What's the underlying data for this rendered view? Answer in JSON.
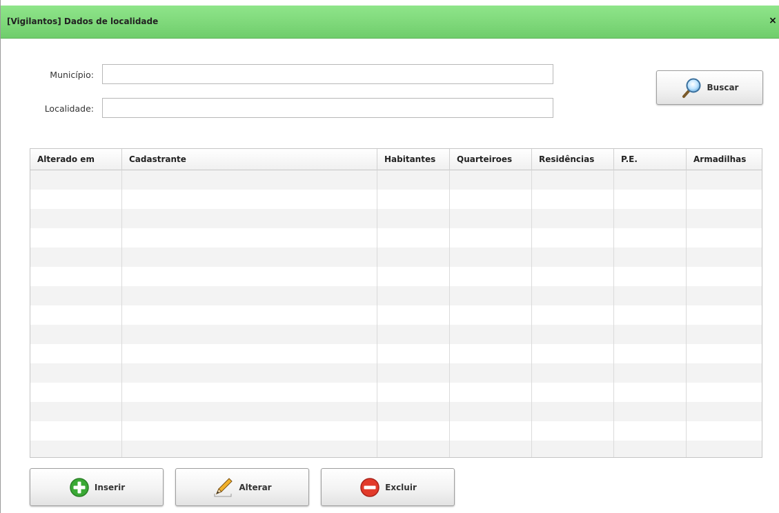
{
  "window": {
    "title": "[Vigilantos] Dados de localidade",
    "close_label": "×"
  },
  "form": {
    "municipio_label": "Município:",
    "municipio_value": "",
    "localidade_label": "Localidade:",
    "localidade_value": "",
    "buscar_label": "Buscar"
  },
  "table": {
    "columns": [
      "Alterado em",
      "Cadastrante",
      "Habitantes",
      "Quarteiroes",
      "Residências",
      "P.E.",
      "Armadilhas"
    ],
    "rows": []
  },
  "actions": {
    "inserir_label": "Inserir",
    "alterar_label": "Alterar",
    "excluir_label": "Excluir"
  },
  "colors": {
    "titlebar": "#7ed87a",
    "add_icon": "#3aa935",
    "delete_icon": "#e23a2a"
  },
  "icons": {
    "search": "magnifier-icon",
    "add": "plus-circle-icon",
    "edit": "pencil-icon",
    "delete": "minus-circle-icon",
    "close": "close-icon"
  }
}
